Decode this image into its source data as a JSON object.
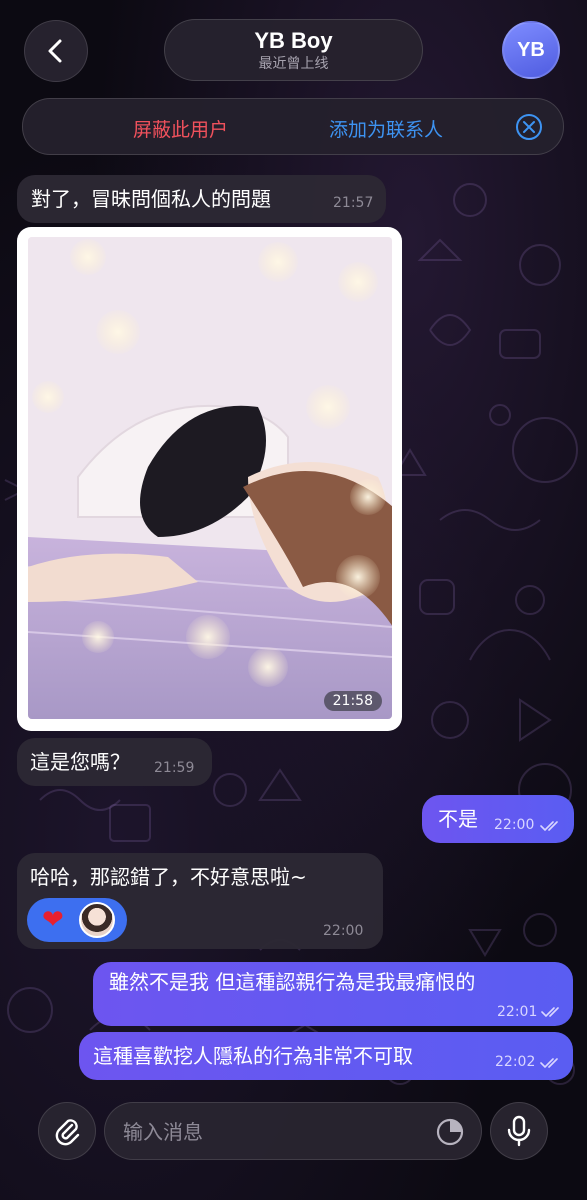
{
  "header": {
    "name": "YB Boy",
    "status": "最近曾上线",
    "avatar_initials": "YB"
  },
  "action_bar": {
    "block_label": "屏蔽此用户",
    "add_contact_label": "添加为联系人"
  },
  "messages": [
    {
      "dir": "in",
      "text": "對了，冒昧問個私人的問題",
      "time": "21:57"
    },
    {
      "dir": "in",
      "type": "photo",
      "time": "21:58"
    },
    {
      "dir": "in",
      "text": "這是您嗎？",
      "time": "21:59"
    },
    {
      "dir": "out",
      "text": "不是",
      "time": "22:00"
    },
    {
      "dir": "in",
      "text": "哈哈，那認錯了，不好意思啦~",
      "time": "22:00",
      "reaction": "❤"
    },
    {
      "dir": "out",
      "text": "雖然不是我 但這種認親行為是我最痛恨的",
      "time": "22:01"
    },
    {
      "dir": "out",
      "text": "這種喜歡挖人隱私的行為非常不可取",
      "time": "22:02"
    }
  ],
  "composer": {
    "placeholder": "输入消息"
  },
  "colors": {
    "incoming_bubble": "#2c2834",
    "outgoing_bubble": "#6356f0",
    "block_red": "#f0515c",
    "add_blue": "#3d93f2",
    "reaction_blue": "#3d6ff0"
  }
}
